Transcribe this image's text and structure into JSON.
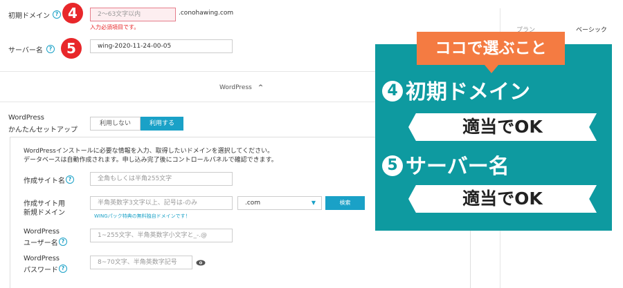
{
  "domain_field": {
    "label": "初期ドメイン",
    "placeholder": "2～63文字以内",
    "suffix": ".conohawing.com",
    "error": "入力必須項目です。",
    "badge": "4"
  },
  "server_field": {
    "label": "サーバー名",
    "value": "wing-2020-11-24-00-05",
    "badge": "5"
  },
  "wordpress_section": {
    "toggle_label": "WordPress",
    "chevron": "^"
  },
  "wp_easy_setup": {
    "label_line1": "WordPress",
    "label_line2": "かんたんセットアップ",
    "options": [
      "利用しない",
      "利用する"
    ],
    "selected": "利用する",
    "selected_color": "#1aa1c7"
  },
  "wp_form": {
    "intro_line1": "WordPressインストールに必要な情報を入力、取得したいドメインを選択してください。",
    "intro_line2": "データベースは自動作成されます。申し込み完了後にコントロールパネルで確認できます。",
    "site_name": {
      "label": "作成サイト名",
      "placeholder": "全角もしくは半角255文字"
    },
    "new_domain": {
      "label_line1": "作成サイト用",
      "label_line2": "新規ドメイン",
      "placeholder": "半角英数字3文字以上、記号は-のみ",
      "tld": ".com",
      "search_button": "検索",
      "note": "WINGパック特典の無料独自ドメインです！"
    },
    "username": {
      "label_line1": "WordPress",
      "label_line2": "ユーザー名",
      "placeholder": "1~255文字、半角英数字小文字と_-.@"
    },
    "password": {
      "label_line1": "WordPress",
      "label_line2": "パスワード",
      "placeholder": "8~70文字、半角英数字記号"
    }
  },
  "plan_header": {
    "plan_label": "プラン",
    "plan_value": "ベーシック"
  },
  "callout": {
    "bubble_text": "ココで選ぶこと",
    "bubble_color": "#f47b42",
    "panel_color": "#0e9aa0",
    "item1_num": "4",
    "item1_title": "初期ドメイン",
    "item1_value": "適当でOK",
    "item2_num": "5",
    "item2_title": "サーバー名",
    "item2_value": "適当でOK"
  }
}
